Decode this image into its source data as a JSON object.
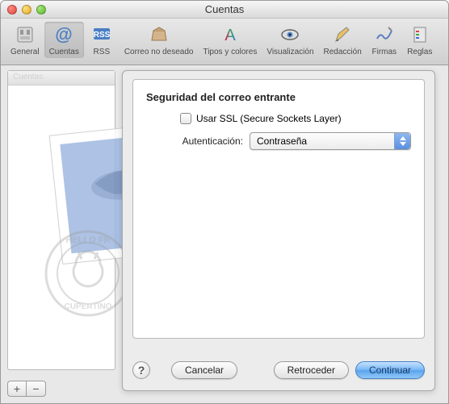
{
  "window": {
    "title": "Cuentas"
  },
  "toolbar": {
    "items": [
      {
        "label": "General"
      },
      {
        "label": "Cuentas"
      },
      {
        "label": "RSS"
      },
      {
        "label": "Correo no deseado"
      },
      {
        "label": "Tipos y colores"
      },
      {
        "label": "Visualización"
      },
      {
        "label": "Redacción"
      },
      {
        "label": "Firmas"
      },
      {
        "label": "Reglas"
      }
    ]
  },
  "sidebar": {
    "header": "Cuentas"
  },
  "sheet": {
    "heading": "Seguridad del correo entrante",
    "ssl_label": "Usar SSL (Secure Sockets Layer)",
    "auth_label": "Autenticación:",
    "auth_value": "Contraseña"
  },
  "buttons": {
    "cancel": "Cancelar",
    "back": "Retroceder",
    "continue": "Continuar",
    "add": "+",
    "remove": "−",
    "help": "?"
  }
}
